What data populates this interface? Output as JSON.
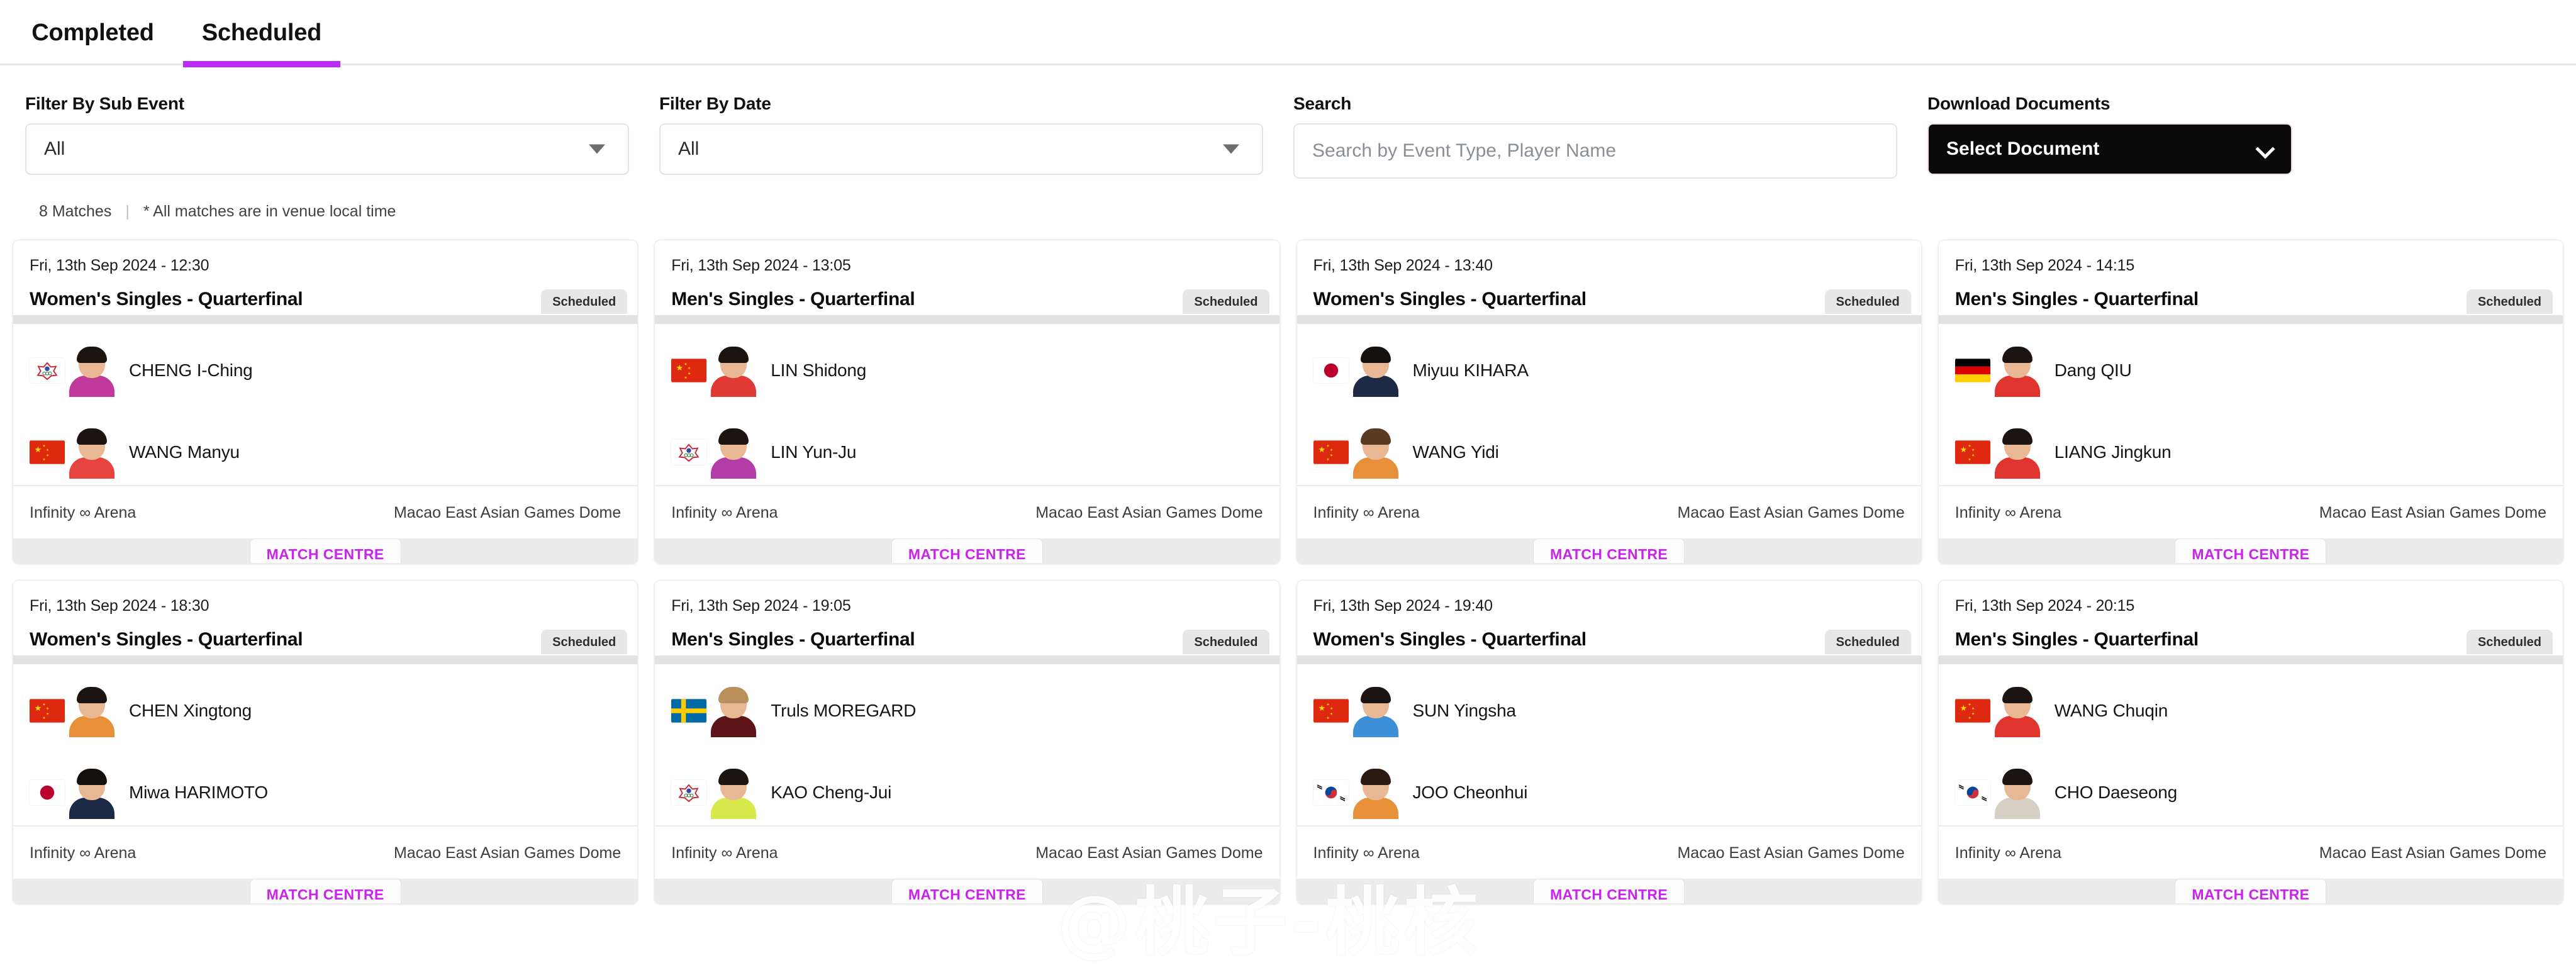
{
  "tabs": [
    {
      "label": "Completed",
      "active": false
    },
    {
      "label": "Scheduled",
      "active": true
    }
  ],
  "filters": {
    "sub_event": {
      "label": "Filter By Sub Event",
      "value": "All"
    },
    "date": {
      "label": "Filter By Date",
      "value": "All"
    },
    "search": {
      "label": "Search",
      "placeholder": "Search by Event Type, Player Name",
      "value": ""
    },
    "documents": {
      "label": "Download Documents",
      "button_label": "Select Document"
    }
  },
  "summary": {
    "match_count": "8 Matches",
    "separator": "|",
    "note": "* All matches are in venue local time"
  },
  "colors": {
    "accent": "#bb2bf5",
    "match_centre_text": "#cc22ee",
    "badge_bg": "#e7e7e7",
    "card_footer_bg": "#ececec",
    "doc_button_bg": "#0a0a0a"
  },
  "match_centre_label": "MATCH CENTRE",
  "watermark": "@桃子-桃核",
  "matches": [
    {
      "date": "Fri, 13th Sep 2024 - 12:30",
      "title": "Women's Singles - Quarterfinal",
      "status": "Scheduled",
      "venue": "Infinity ∞ Arena",
      "location": "Macao East Asian Games Dome",
      "players": [
        {
          "name": "CHENG I-Ching",
          "flag": "TPE",
          "kit": "#c03a9c",
          "hair": "#1b1411"
        },
        {
          "name": "WANG Manyu",
          "flag": "CHN",
          "kit": "#e8443f",
          "hair": "#1b1411"
        }
      ]
    },
    {
      "date": "Fri, 13th Sep 2024 - 13:05",
      "title": "Men's Singles - Quarterfinal",
      "status": "Scheduled",
      "venue": "Infinity ∞ Arena",
      "location": "Macao East Asian Games Dome",
      "players": [
        {
          "name": "LIN Shidong",
          "flag": "CHN",
          "kit": "#e03a34",
          "hair": "#1b1411"
        },
        {
          "name": "LIN Yun-Ju",
          "flag": "TPE",
          "kit": "#b43ca6",
          "hair": "#1b1411"
        }
      ]
    },
    {
      "date": "Fri, 13th Sep 2024 - 13:40",
      "title": "Women's Singles - Quarterfinal",
      "status": "Scheduled",
      "venue": "Infinity ∞ Arena",
      "location": "Macao East Asian Games Dome",
      "players": [
        {
          "name": "Miyuu KIHARA",
          "flag": "JPN",
          "kit": "#1d2a46",
          "hair": "#14100e"
        },
        {
          "name": "WANG Yidi",
          "flag": "CHN",
          "kit": "#e6913a",
          "hair": "#5a3a21"
        }
      ]
    },
    {
      "date": "Fri, 13th Sep 2024 - 14:15",
      "title": "Men's Singles - Quarterfinal",
      "status": "Scheduled",
      "venue": "Infinity ∞ Arena",
      "location": "Macao East Asian Games Dome",
      "players": [
        {
          "name": "Dang QIU",
          "flag": "GER",
          "kit": "#e0342f",
          "hair": "#1b1411"
        },
        {
          "name": "LIANG Jingkun",
          "flag": "CHN",
          "kit": "#e0342f",
          "hair": "#1b1411"
        }
      ]
    },
    {
      "date": "Fri, 13th Sep 2024 - 18:30",
      "title": "Women's Singles - Quarterfinal",
      "status": "Scheduled",
      "venue": "Infinity ∞ Arena",
      "location": "Macao East Asian Games Dome",
      "players": [
        {
          "name": "CHEN Xingtong",
          "flag": "CHN",
          "kit": "#e6913a",
          "hair": "#1b1411"
        },
        {
          "name": "Miwa HARIMOTO",
          "flag": "JPN",
          "kit": "#1d2a46",
          "hair": "#14100e"
        }
      ]
    },
    {
      "date": "Fri, 13th Sep 2024 - 19:05",
      "title": "Men's Singles - Quarterfinal",
      "status": "Scheduled",
      "venue": "Infinity ∞ Arena",
      "location": "Macao East Asian Games Dome",
      "players": [
        {
          "name": "Truls MOREGARD",
          "flag": "SWE",
          "kit": "#5c1416",
          "hair": "#b8905c"
        },
        {
          "name": "KAO Cheng-Jui",
          "flag": "TPE",
          "kit": "#d6e84a",
          "hair": "#1b1411"
        }
      ]
    },
    {
      "date": "Fri, 13th Sep 2024 - 19:40",
      "title": "Women's Singles - Quarterfinal",
      "status": "Scheduled",
      "venue": "Infinity ∞ Arena",
      "location": "Macao East Asian Games Dome",
      "players": [
        {
          "name": "SUN Yingsha",
          "flag": "CHN",
          "kit": "#3d8fd6",
          "hair": "#1b1411"
        },
        {
          "name": "JOO Cheonhui",
          "flag": "KOR",
          "kit": "#e8913a",
          "hair": "#2b1a12"
        }
      ]
    },
    {
      "date": "Fri, 13th Sep 2024 - 20:15",
      "title": "Men's Singles - Quarterfinal",
      "status": "Scheduled",
      "venue": "Infinity ∞ Arena",
      "location": "Macao East Asian Games Dome",
      "players": [
        {
          "name": "WANG Chuqin",
          "flag": "CHN",
          "kit": "#e0342f",
          "hair": "#1b1411"
        },
        {
          "name": "CHO Daeseong",
          "flag": "KOR",
          "kit": "#d8cfc4",
          "hair": "#1b1411"
        }
      ]
    }
  ]
}
